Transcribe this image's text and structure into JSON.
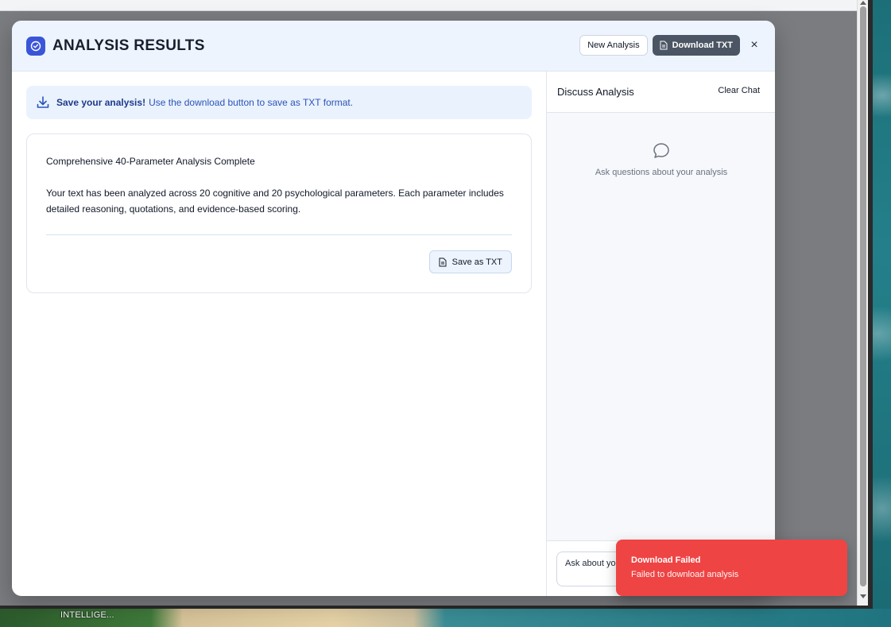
{
  "modal": {
    "title": "ANALYSIS RESULTS",
    "new_analysis_label": "New Analysis",
    "download_txt_label": "Download TXT",
    "close_label": "×"
  },
  "notice": {
    "strong": "Save your analysis!",
    "text": "Use the download button to save as TXT format."
  },
  "card": {
    "title": "Comprehensive 40-Parameter Analysis Complete",
    "description": "Your text has been analyzed across 20 cognitive and 20 psychological parameters. Each parameter includes detailed reasoning, quotations, and evidence-based scoring.",
    "save_label": "Save as TXT"
  },
  "chat": {
    "title": "Discuss Analysis",
    "clear_label": "Clear Chat",
    "empty_text": "Ask questions about your analysis",
    "input_placeholder": "Ask about your analysis..."
  },
  "toast": {
    "title": "Download Failed",
    "message": "Failed to download analysis",
    "color": "#ef4444"
  },
  "taskbar": {
    "label": "INTELLIGE..."
  },
  "colors": {
    "accent": "#3b55d8",
    "header_bg": "#eef4fe",
    "dark_button": "#4b5563"
  }
}
